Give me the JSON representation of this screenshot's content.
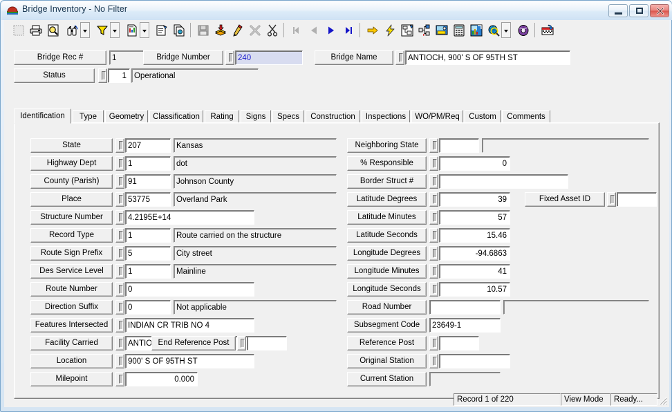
{
  "window": {
    "title": "Bridge Inventory - No Filter",
    "icon": "bridge-icon",
    "minimize_label": "",
    "maximize_label": "",
    "close_label": ""
  },
  "toolbar": {
    "buttons": [
      {
        "name": "print-preview-icon",
        "label": "Print Preview",
        "framed": false,
        "disabled": true
      },
      {
        "name": "print-icon",
        "label": "Print",
        "framed": false
      },
      {
        "name": "find-icon",
        "label": "Find",
        "framed": false
      },
      {
        "name": "binoculars-search-icon",
        "label": "Search",
        "framed": false
      },
      {
        "name": "filter-funnel-icon",
        "label": "Filter",
        "framed": false
      },
      {
        "name": "report-icon",
        "label": "Report",
        "framed": false
      },
      {
        "name": "properties-icon",
        "label": "Properties",
        "framed": false
      },
      {
        "name": "copy-record-icon",
        "label": "Copy Record",
        "framed": false
      },
      {
        "name": "save-icon",
        "label": "Save",
        "framed": false,
        "disabled": true
      },
      {
        "name": "add-record-icon",
        "label": "Add Record",
        "framed": false
      },
      {
        "name": "edit-record-icon",
        "label": "Edit Record",
        "framed": false
      },
      {
        "name": "delete-record-icon",
        "label": "Delete Record",
        "framed": false,
        "disabled": true
      },
      {
        "name": "cut-icon",
        "label": "Cut",
        "framed": false
      },
      {
        "name": "first-record-icon",
        "label": "First Record",
        "framed": false,
        "disabled": true
      },
      {
        "name": "previous-record-icon",
        "label": "Previous Record",
        "framed": false,
        "disabled": true
      },
      {
        "name": "next-record-icon",
        "label": "Next Record",
        "framed": false
      },
      {
        "name": "last-record-icon",
        "label": "Last Record",
        "framed": false
      },
      {
        "name": "goto-icon",
        "label": "Go To",
        "framed": false
      },
      {
        "name": "lightning-icon",
        "label": "Quick Action",
        "framed": false
      },
      {
        "name": "diagram-icon",
        "label": "Diagram",
        "framed": false
      },
      {
        "name": "structure-tree-icon",
        "label": "Structure Tree",
        "framed": false
      },
      {
        "name": "sketch-icon",
        "label": "Sketch",
        "framed": false
      },
      {
        "name": "calculator-icon",
        "label": "Calculator",
        "framed": false
      },
      {
        "name": "chart-icon",
        "label": "Chart",
        "framed": false
      },
      {
        "name": "globe-search-icon",
        "label": "Map",
        "framed": false
      },
      {
        "name": "help-book-icon",
        "label": "Help",
        "framed": false
      },
      {
        "name": "exit-icon",
        "label": "Exit",
        "framed": false
      }
    ]
  },
  "header": {
    "bridge_rec_label": "Bridge Rec #",
    "bridge_rec_value": "1",
    "bridge_number_label": "Bridge Number",
    "bridge_number_value": "240",
    "bridge_name_label": "Bridge Name",
    "bridge_name_value": "ANTIOCH,  900' S OF 95TH ST",
    "status_label": "Status",
    "status_code": "1",
    "status_desc": "Operational"
  },
  "tabs": [
    {
      "label": "Identification",
      "active": true
    },
    {
      "label": "Type",
      "active": false
    },
    {
      "label": "Geometry",
      "active": false
    },
    {
      "label": "Classification",
      "active": false
    },
    {
      "label": "Rating",
      "active": false
    },
    {
      "label": "Signs",
      "active": false
    },
    {
      "label": "Specs",
      "active": false
    },
    {
      "label": "Construction",
      "active": false
    },
    {
      "label": "Inspections",
      "active": false
    },
    {
      "label": "WO/PM/Req",
      "active": false
    },
    {
      "label": "Custom",
      "active": false
    },
    {
      "label": "Comments",
      "active": false
    }
  ],
  "left_fields": [
    {
      "label": "State",
      "code": "207",
      "desc": "Kansas",
      "code_w": 66,
      "has_desc": true,
      "spin": true
    },
    {
      "label": "Highway Dept",
      "code": "1",
      "desc": "dot",
      "code_w": 66,
      "has_desc": true,
      "spin": true
    },
    {
      "label": "County (Parish)",
      "code": "91",
      "desc": "Johnson County",
      "code_w": 66,
      "has_desc": true,
      "spin": true
    },
    {
      "label": "Place",
      "code": "53775",
      "desc": "Overland Park",
      "code_w": 66,
      "has_desc": true,
      "spin": true
    },
    {
      "label": "Structure Number",
      "code": "4.2195E+14",
      "desc": "",
      "code_w": 187,
      "has_desc": false,
      "spin": true
    },
    {
      "label": "Record Type",
      "code": "1",
      "desc": "Route carried on the structure",
      "code_w": 66,
      "has_desc": true,
      "spin": true
    },
    {
      "label": "Route Sign Prefix",
      "code": "5",
      "desc": "City street",
      "code_w": 66,
      "has_desc": true,
      "spin": true
    },
    {
      "label": "Des Service Level",
      "code": "1",
      "desc": "Mainline",
      "code_w": 66,
      "has_desc": true,
      "spin": true
    },
    {
      "label": "Route Number",
      "code": "0",
      "desc": "",
      "code_w": 187,
      "has_desc": false,
      "spin": true
    },
    {
      "label": "Direction Suffix",
      "code": "0",
      "desc": "Not applicable",
      "code_w": 66,
      "has_desc": true,
      "spin": true
    },
    {
      "label": "Features Intersected",
      "code": "INDIAN CR TRIB NO 4",
      "desc": "",
      "code_w": 187,
      "has_desc": false,
      "spin": true
    },
    {
      "label": "Facility Carried",
      "code": "ANTIOCH",
      "desc": "",
      "code_w": 187,
      "has_desc": false,
      "spin": true
    },
    {
      "label": "Location",
      "code": "900' S OF 95TH ST",
      "desc": "",
      "code_w": 187,
      "has_desc": false,
      "spin": true
    },
    {
      "label": "Milepoint",
      "code": "0.000",
      "desc": "",
      "code_w": 105,
      "has_desc": false,
      "spin": true,
      "align": "right"
    }
  ],
  "right_fields": [
    {
      "label": "Neighboring State",
      "code": "",
      "desc": "",
      "code_w": 58,
      "has_desc": true,
      "spin": true
    },
    {
      "label": "% Responsible",
      "code": "0",
      "desc": "",
      "code_w": 103,
      "has_desc": false,
      "spin": true,
      "align": "right"
    },
    {
      "label": "Border Struct #",
      "code": "",
      "desc": "",
      "code_w": 187,
      "has_desc": false,
      "spin": true
    },
    {
      "label": "Latitude Degrees",
      "code": "39",
      "desc": "",
      "code_w": 103,
      "has_desc": false,
      "spin": true,
      "align": "right"
    },
    {
      "label": "Latitude Minutes",
      "code": "57",
      "desc": "",
      "code_w": 103,
      "has_desc": false,
      "spin": true,
      "align": "right"
    },
    {
      "label": "Latitude Seconds",
      "code": "15.46",
      "desc": "",
      "code_w": 103,
      "has_desc": false,
      "spin": true,
      "align": "right"
    },
    {
      "label": "Longitude Degrees",
      "code": "-94.6863",
      "desc": "",
      "code_w": 103,
      "has_desc": false,
      "spin": true,
      "align": "right"
    },
    {
      "label": "Longitude Minutes",
      "code": "41",
      "desc": "",
      "code_w": 103,
      "has_desc": false,
      "spin": true,
      "align": "right"
    },
    {
      "label": "Longitude Seconds",
      "code": "10.57",
      "desc": "",
      "code_w": 103,
      "has_desc": false,
      "spin": true,
      "align": "right"
    },
    {
      "label": "Road Number",
      "code": "",
      "desc": "",
      "code_w": 103,
      "has_desc": true,
      "spin": false
    },
    {
      "label": "Subsegment Code",
      "code": "23649-1",
      "desc": "",
      "code_w": 103,
      "has_desc": false,
      "spin": false
    },
    {
      "label": "Reference Post",
      "code": "",
      "desc": "",
      "code_w": 58,
      "has_desc": false,
      "spin": true
    },
    {
      "label": "Original Station",
      "code": "",
      "desc": "",
      "code_w": 103,
      "has_desc": false,
      "spin": true
    },
    {
      "label": "Current Station",
      "code": "",
      "desc": "",
      "code_w": 103,
      "has_desc": false,
      "spin": false,
      "readonly": true
    }
  ],
  "extra_fields": {
    "fixed_asset_id_label": "Fixed Asset ID",
    "fixed_asset_id_value": "",
    "end_reference_post_label": "End Reference Post",
    "end_reference_post_value": ""
  },
  "statusbar": {
    "record": "Record 1 of 220",
    "mode": "View Mode",
    "state": "Ready..."
  },
  "colors": {
    "face": "#f0f0f0",
    "selected_text": "#2222cc",
    "selected_bg": "#d8dcf0",
    "titlebar_text": "#16344f"
  }
}
